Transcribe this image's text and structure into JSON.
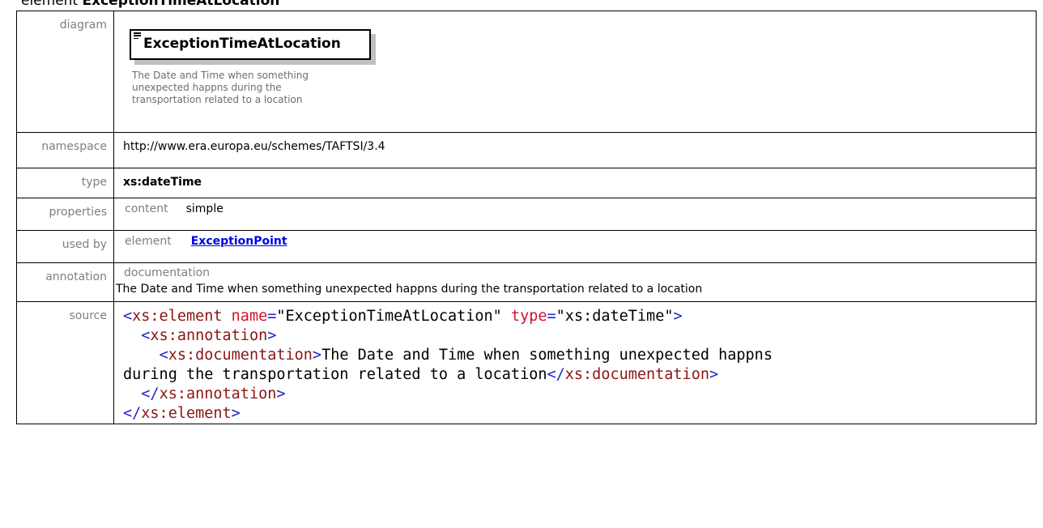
{
  "heading": {
    "prefix": "element",
    "name": "ExceptionTimeAtLocation"
  },
  "labels": {
    "diagram": "diagram",
    "namespace": "namespace",
    "type": "type",
    "properties": "properties",
    "used_by": "used by",
    "annotation": "annotation",
    "source": "source"
  },
  "diagram": {
    "element_name": "ExceptionTimeAtLocation",
    "description": "The Date and Time when something unexpected happns during the transportation related to a location"
  },
  "namespace": "http://www.era.europa.eu/schemes/TAFTSI/3.4",
  "type": "xs:dateTime",
  "properties": {
    "key": "content",
    "value": "simple"
  },
  "used_by": {
    "kind": "element",
    "link": "ExceptionPoint"
  },
  "annotation": {
    "label": "documentation",
    "text": "The Date and Time when something unexpected happns during the transportation related to a location"
  },
  "source": {
    "line1": {
      "open": "<",
      "tag": "xs:element",
      "attr1_name": "name",
      "eq1": "=",
      "attr1_value": "\"ExceptionTimeAtLocation\"",
      "attr2_name": "type",
      "eq2": "=",
      "attr2_value": "\"xs:dateTime\"",
      "close": ">"
    },
    "line2": {
      "indent": "  ",
      "open": "<",
      "tag": "xs:annotation",
      "close": ">"
    },
    "line3": {
      "indent": "    ",
      "open": "<",
      "tag": "xs:documentation",
      "close": ">",
      "text": "The Date and Time when something unexpected happns"
    },
    "line4": {
      "text": "during the transportation related to a location",
      "open": "</",
      "tag": "xs:documentation",
      "close": ">"
    },
    "line5": {
      "indent": "  ",
      "open": "</",
      "tag": "xs:annotation",
      "close": ">"
    },
    "line6": {
      "open": "</",
      "tag": "xs:element",
      "close": ">"
    }
  },
  "colors": {
    "markup_bracket": "#1f24c8",
    "element_name": "#8b1515",
    "attribute_name": "#d0112f",
    "attribute_value": "#1f24c8",
    "link": "#0000ee",
    "label_gray": "#7f7f7f"
  },
  "icons": {
    "diagram_box_icon": "element-lines-icon"
  }
}
